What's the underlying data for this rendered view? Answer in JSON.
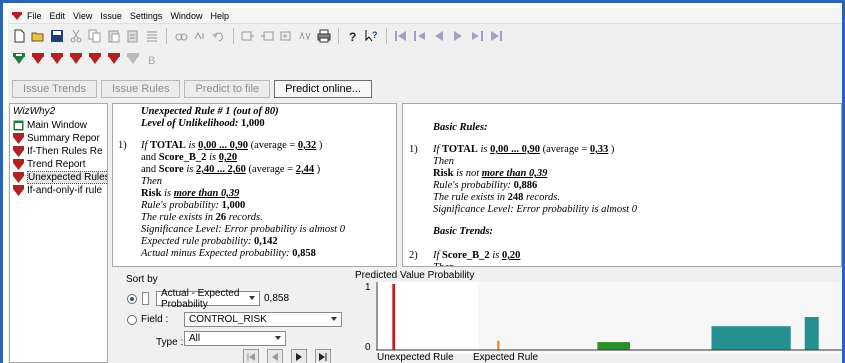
{
  "menu": [
    "File",
    "Edit",
    "View",
    "Issue",
    "Settings",
    "Window",
    "Help"
  ],
  "tabs": [
    {
      "label": "Issue Trends",
      "active": false
    },
    {
      "label": "Issue Rules",
      "active": false
    },
    {
      "label": "Predict to file",
      "active": false
    },
    {
      "label": "Predict online...",
      "active": true
    }
  ],
  "tree": {
    "root": "WizWhy2",
    "items": [
      {
        "label": "Main Window",
        "icon": "window-icon"
      },
      {
        "label": "Summary Repor",
        "icon": "rule-icon"
      },
      {
        "label": "If-Then Rules Re",
        "icon": "rule-icon"
      },
      {
        "label": "Trend Report",
        "icon": "rule-icon"
      },
      {
        "label": "Unexpected Rules",
        "icon": "rule-icon",
        "selected": true
      },
      {
        "label": "If-and-only-if rule",
        "icon": "rule-icon"
      }
    ]
  },
  "left_pane": {
    "header_title": "Unexpected Rule # 1",
    "header_count": "(out of 80)",
    "level_label": "Level of Unlikelihood:",
    "level_value": "1,000",
    "rule_num": "1)",
    "if_word": "If",
    "c1_field": "TOTAL",
    "is_word": "is",
    "c1_range": "0,00 ... 0,90",
    "avg_open": "(average =",
    "c1_avg": "0,32",
    "avg_close": ")",
    "and_word": "and",
    "c2_field": "Score_B_2",
    "c2_value": "0,20",
    "c3_field": "Score",
    "c3_range": "2,40 ... 2,60",
    "c3_avg": "2,44",
    "then_word": "Then",
    "result_field": "Risk",
    "result_value": "more than 0,39",
    "prob_label": "Rule's probability:",
    "prob_value": "1,000",
    "exists_prefix": "The rule exists in",
    "exists_count": "26",
    "exists_suffix": "records.",
    "significance": "Significance Level:  Error probability is almost 0",
    "expected_label": "Expected rule probability:",
    "expected_value": "0,142",
    "actual_label": "Actual minus Expected probability:",
    "actual_value": "0,858"
  },
  "right_pane": {
    "basic_rules": "Basic Rules:",
    "rule1_num": "1)",
    "if_word": "If",
    "r1_field": "TOTAL",
    "is_word": "is",
    "r1_range": "0,00 ... 0,90",
    "avg_open": "(average =",
    "r1_avg": "0,33",
    "avg_close": ")",
    "then_word": "Then",
    "r1_result_field": "Risk",
    "r1_is_not": "is not",
    "r1_result_value": "more than 0,39",
    "prob_label": "Rule's probability:",
    "prob_value": "0,886",
    "exists_prefix": "The rule exists in",
    "exists_count": "248",
    "exists_suffix": "records.",
    "significance": "Significance Level:  Error probability is almost 0",
    "basic_trends": "Basic Trends:",
    "rule2_num": "2)",
    "r2_field": "Score_B_2",
    "r2_value": "0,20"
  },
  "controls": {
    "sort_by": "Sort by",
    "sort_option": "Actual - Expected Probability",
    "sort_value": "0,858",
    "field_label": "Field :",
    "field_value": "CONTROL_RISK",
    "type_label": "Type :",
    "type_value": "All"
  },
  "chart_data": {
    "type": "bar",
    "title": "Predicted Value Probability",
    "ylim": [
      0,
      1
    ],
    "yticks": [
      "1",
      "0"
    ],
    "x_labels": [
      "Unexpected Rule",
      "Expected Rule"
    ],
    "bars": [
      {
        "x": 0.035,
        "width": 0.006,
        "value": 1.0,
        "color": "#c0201e"
      },
      {
        "x": 0.26,
        "width": 0.005,
        "value": 0.142,
        "color": "#f08a1c"
      },
      {
        "x": 0.475,
        "width": 0.07,
        "value": 0.12,
        "color": "#2b8f2b"
      },
      {
        "x": 0.72,
        "width": 0.17,
        "value": 0.36,
        "color": "#25908f"
      },
      {
        "x": 0.92,
        "width": 0.03,
        "value": 0.5,
        "color": "#25908f"
      }
    ],
    "shading_start": 0.22
  }
}
